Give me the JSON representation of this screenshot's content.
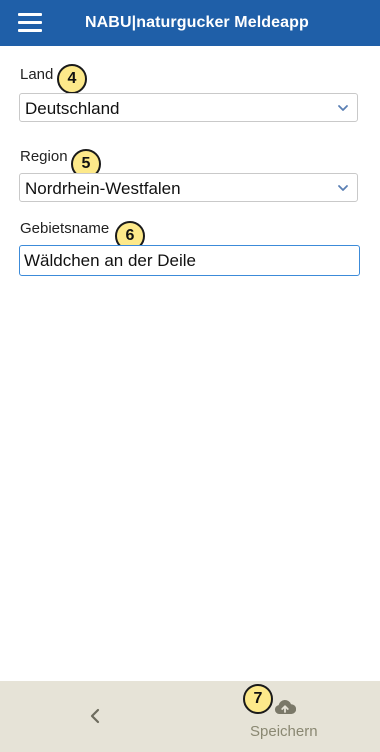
{
  "appbar": {
    "title": "NABU|naturgucker Meldeapp",
    "menu_icon": "hamburger-menu-icon"
  },
  "form": {
    "country": {
      "label": "Land",
      "value": "Deutschland",
      "step": "4",
      "icon": "chevron-down-icon"
    },
    "region": {
      "label": "Region",
      "value": "Nordrhein-Westfalen",
      "step": "5",
      "icon": "chevron-down-icon"
    },
    "area_name": {
      "label": "Gebietsname",
      "value": "Wäldchen an der Deile",
      "step": "6"
    }
  },
  "bottom_bar": {
    "back_icon": "chevron-left-icon",
    "save": {
      "label": "Speichern",
      "step": "7",
      "icon": "cloud-upload-icon"
    }
  },
  "colors": {
    "appbar": "#1f5fa8",
    "bottom_bar": "#e6e3d7",
    "input_focus_border": "#3c8bd9",
    "badge_fill": "#fde98a"
  }
}
